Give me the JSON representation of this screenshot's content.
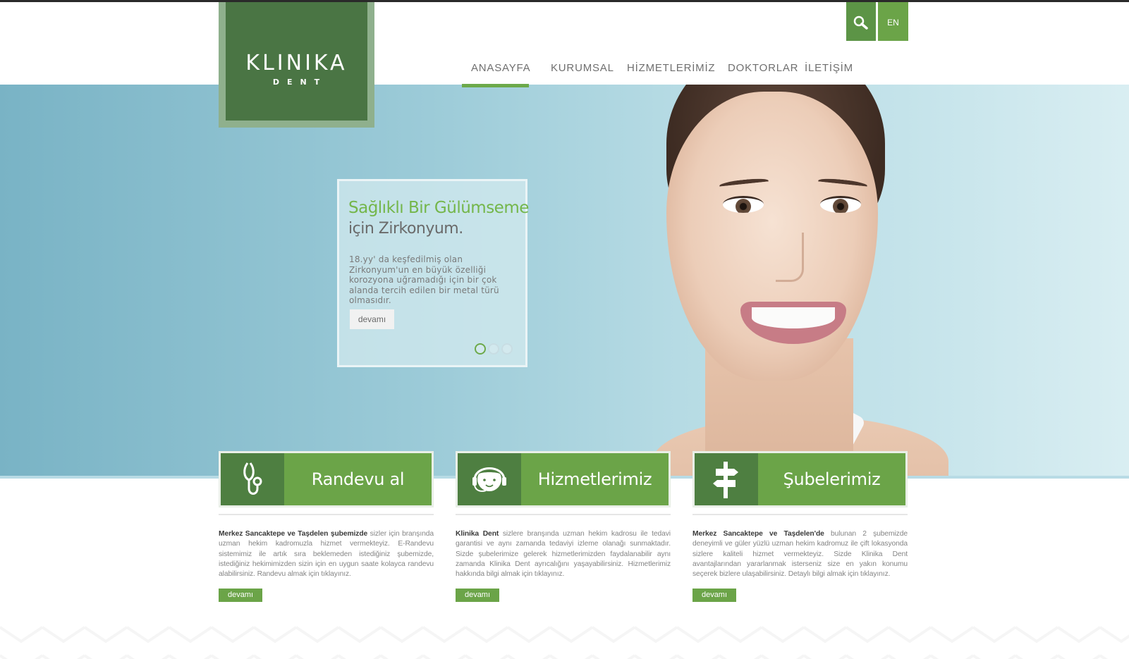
{
  "brand": {
    "name": "KLINIKA",
    "sub": "DENT",
    "green": "#6ba448",
    "dark_green": "#4a7544"
  },
  "header": {
    "search_icon": "search-icon",
    "lang": "EN",
    "nav": [
      {
        "label": "ANASAYFA",
        "active": true
      },
      {
        "label": "KURUMSAL"
      },
      {
        "label": "HİZMETLERİMİZ"
      },
      {
        "label": "DOKTORLAR"
      },
      {
        "label": "İLETİŞİM"
      }
    ]
  },
  "slide": {
    "title_green": "Sağlıklı Bir Gülümseme",
    "title_gray": "için Zirkonyum.",
    "text": "18.yy' da keşfedilmiş olan Zirkonyum'un en büyük özelliği korozyona uğramadığı için bir çok alanda tercih edilen bir metal türü olmasıdır.",
    "button": "devamı",
    "dots_total": 3,
    "dots_active": 1
  },
  "features": [
    {
      "title": "Randevu al",
      "icon": "stethoscope-icon",
      "lead": "Merkez Sancaktepe ve Taşdelen şubemizde",
      "text": " sizler için branşında uzman hekim kadromuzla hizmet vermekteyiz. E-Randevu sistemimiz ile artık sıra beklemeden istediğiniz şubemizde, istediğiniz hekimimizden sizin için en uygun saate kolayca randevu alabilirsiniz. Randevu almak için tıklayınız.",
      "button": "devamı"
    },
    {
      "title": "Hizmetlerimiz",
      "icon": "headset-icon",
      "lead": "Klinika Dent",
      "text": " sizlere branşında uzman hekim kadrosu ile tedavi garantisi ve aynı zamanda tedaviyi izleme olanağı sunmaktadır. Sizde şubelerimize gelerek hizmetlerimizden faydalanabilir aynı zamanda Klinika Dent ayrıcalığını yaşayabilirsiniz.  Hizmetlerimiz hakkında bilgi almak için tıklayınız.",
      "button": "devamı"
    },
    {
      "title": "Şubelerimiz",
      "icon": "signpost-icon",
      "lead": "Merkez Sancaktepe ve Taşdelen'de",
      "text": " bulunan 2 şubemizde deneyimli ve güler yüzlü uzman hekim kadromuz ile çift lokasyonda sizlere kaliteli hizmet vermekteyiz. Sizde Klinika Dent avantajlarından yararlanmak isterseniz size en yakın konumu seçerek bizlere ulaşabilirsiniz. Detaylı bilgi almak için tıklayınız.",
      "button": "devamı"
    }
  ]
}
